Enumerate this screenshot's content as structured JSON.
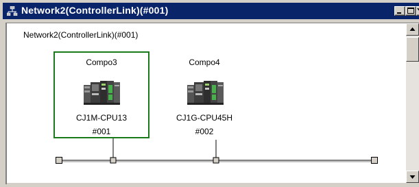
{
  "window": {
    "title": "Network2(ControllerLink)(#001)"
  },
  "canvas": {
    "network_caption": "Network2(ControllerLink)(#001)"
  },
  "nodes": [
    {
      "name": "Compo3",
      "model": "CJ1M-CPU13",
      "address": "#001",
      "selected": true
    },
    {
      "name": "Compo4",
      "model": "CJ1G-CPU45H",
      "address": "#002",
      "selected": false
    }
  ],
  "colors": {
    "titlebar": "#0a246a",
    "selection": "#1a7a1a",
    "canvas": "#ffffff",
    "chrome": "#d4d0c8"
  },
  "icons": {
    "window_icon": "network-icon",
    "minimize": "minimize-icon",
    "maximize": "maximize-icon",
    "close": "close-icon",
    "plc_device": "plc-unit-icon",
    "scroll_up": "arrow-up-icon",
    "scroll_down": "arrow-down-icon"
  }
}
